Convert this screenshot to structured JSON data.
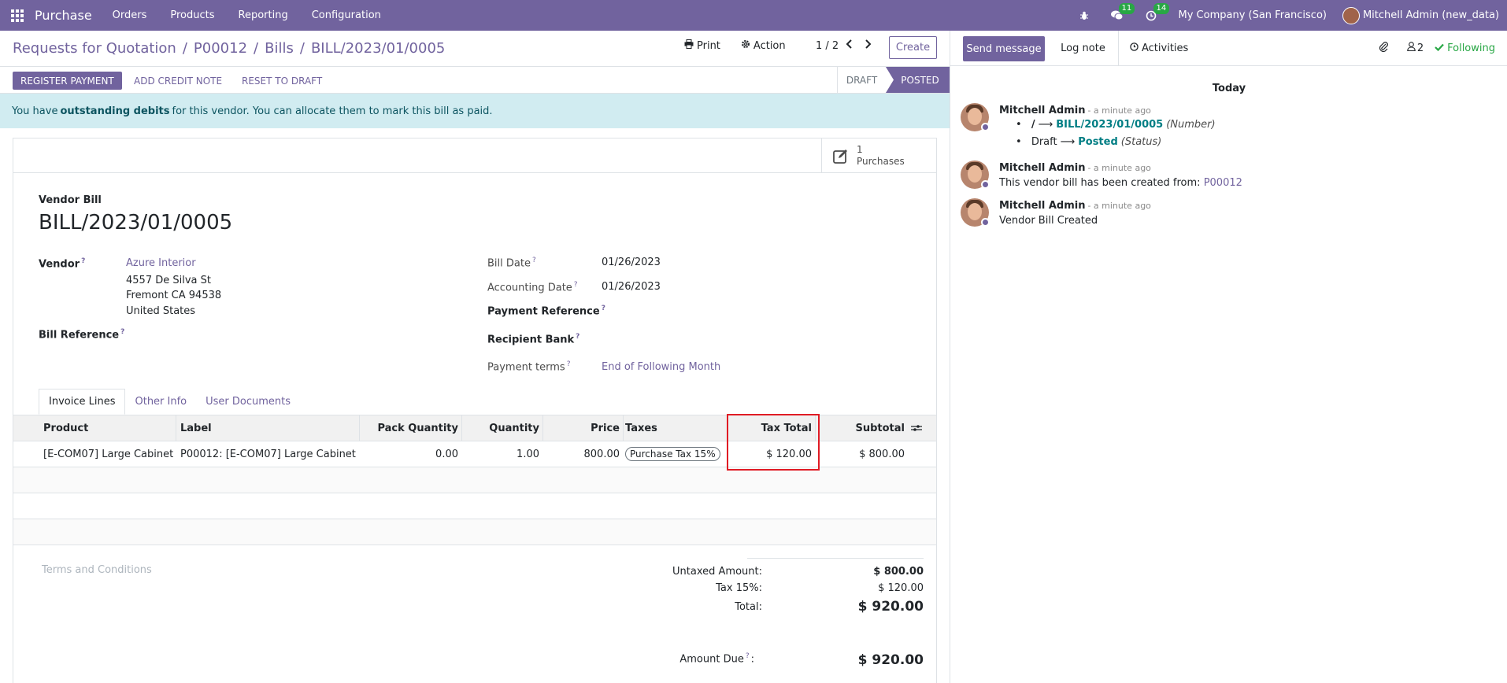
{
  "navbar": {
    "app_name": "Purchase",
    "menu": [
      "Orders",
      "Products",
      "Reporting",
      "Configuration"
    ],
    "messages_badge": "11",
    "activities_badge": "14",
    "company": "My Company (San Francisco)",
    "user": "Mitchell Admin (new_data)"
  },
  "breadcrumb": {
    "items": [
      "Requests for Quotation",
      "P00012",
      "Bills"
    ],
    "current": "BILL/2023/01/0005"
  },
  "control": {
    "print_label": "Print",
    "action_label": "Action",
    "pager": "1 / 2",
    "create_label": "Create"
  },
  "statusbar": {
    "register_payment": "REGISTER PAYMENT",
    "add_credit_note": "ADD CREDIT NOTE",
    "reset_to_draft": "RESET TO DRAFT",
    "stage_draft": "DRAFT",
    "stage_posted": "POSTED"
  },
  "alert": {
    "before": "You have",
    "bold": "outstanding debits",
    "after": "for this vendor. You can allocate them to mark this bill as paid."
  },
  "smart_button": {
    "count": "1",
    "label": "Purchases"
  },
  "form": {
    "bill_type": "Vendor Bill",
    "bill_name": "BILL/2023/01/0005",
    "vendor_label": "Vendor",
    "vendor_name": "Azure Interior",
    "vendor_address": [
      "4557 De Silva St",
      "Fremont CA 94538",
      "United States"
    ],
    "bill_reference_label": "Bill Reference",
    "bill_date_label": "Bill Date",
    "bill_date": "01/26/2023",
    "accounting_date_label": "Accounting Date",
    "accounting_date": "01/26/2023",
    "payment_reference_label": "Payment Reference",
    "recipient_bank_label": "Recipient Bank",
    "payment_terms_label": "Payment terms",
    "payment_terms": "End of Following Month",
    "tooltip_mark": "?"
  },
  "tabs": [
    "Invoice Lines",
    "Other Info",
    "User Documents"
  ],
  "lines": {
    "headers": [
      "Product",
      "Label",
      "Pack Quantity",
      "Quantity",
      "Price",
      "Taxes",
      "Tax Total",
      "Subtotal"
    ],
    "rows": [
      {
        "product": "[E-COM07] Large Cabinet",
        "label": "P00012: [E-COM07] Large Cabinet",
        "pack_quantity": "0.00",
        "quantity": "1.00",
        "price": "800.00",
        "taxes": "Purchase Tax 15%",
        "tax_total": "$ 120.00",
        "subtotal": "$ 800.00"
      }
    ]
  },
  "terms_placeholder": "Terms and Conditions",
  "totals": {
    "untaxed_label": "Untaxed Amount:",
    "untaxed_value": "$ 800.00",
    "tax_label": "Tax 15%:",
    "tax_value": "$ 120.00",
    "total_label": "Total:",
    "total_value": "$ 920.00",
    "amount_due_label": "Amount Due",
    "amount_due_value": "$ 920.00"
  },
  "chatter": {
    "send_message": "Send message",
    "log_note": "Log note",
    "activities": "Activities",
    "followers_count": "2",
    "following": "Following",
    "today": "Today",
    "messages": [
      {
        "author": "Mitchell Admin",
        "time": "- a minute ago",
        "tracking": [
          {
            "old": "/",
            "new": "BILL/2023/01/0005",
            "field": "(Number)"
          },
          {
            "old": "Draft",
            "new": "Posted",
            "field": "(Status)"
          }
        ]
      },
      {
        "author": "Mitchell Admin",
        "time": "- a minute ago",
        "body": "This vendor bill has been created from:",
        "link": "P00012"
      },
      {
        "author": "Mitchell Admin",
        "time": "- a minute ago",
        "body": "Vendor Bill Created"
      }
    ]
  },
  "colors": {
    "brand": "#71639e",
    "alert_bg": "#d1ecf1",
    "success": "#28a745",
    "highlight": "#e01b24"
  }
}
